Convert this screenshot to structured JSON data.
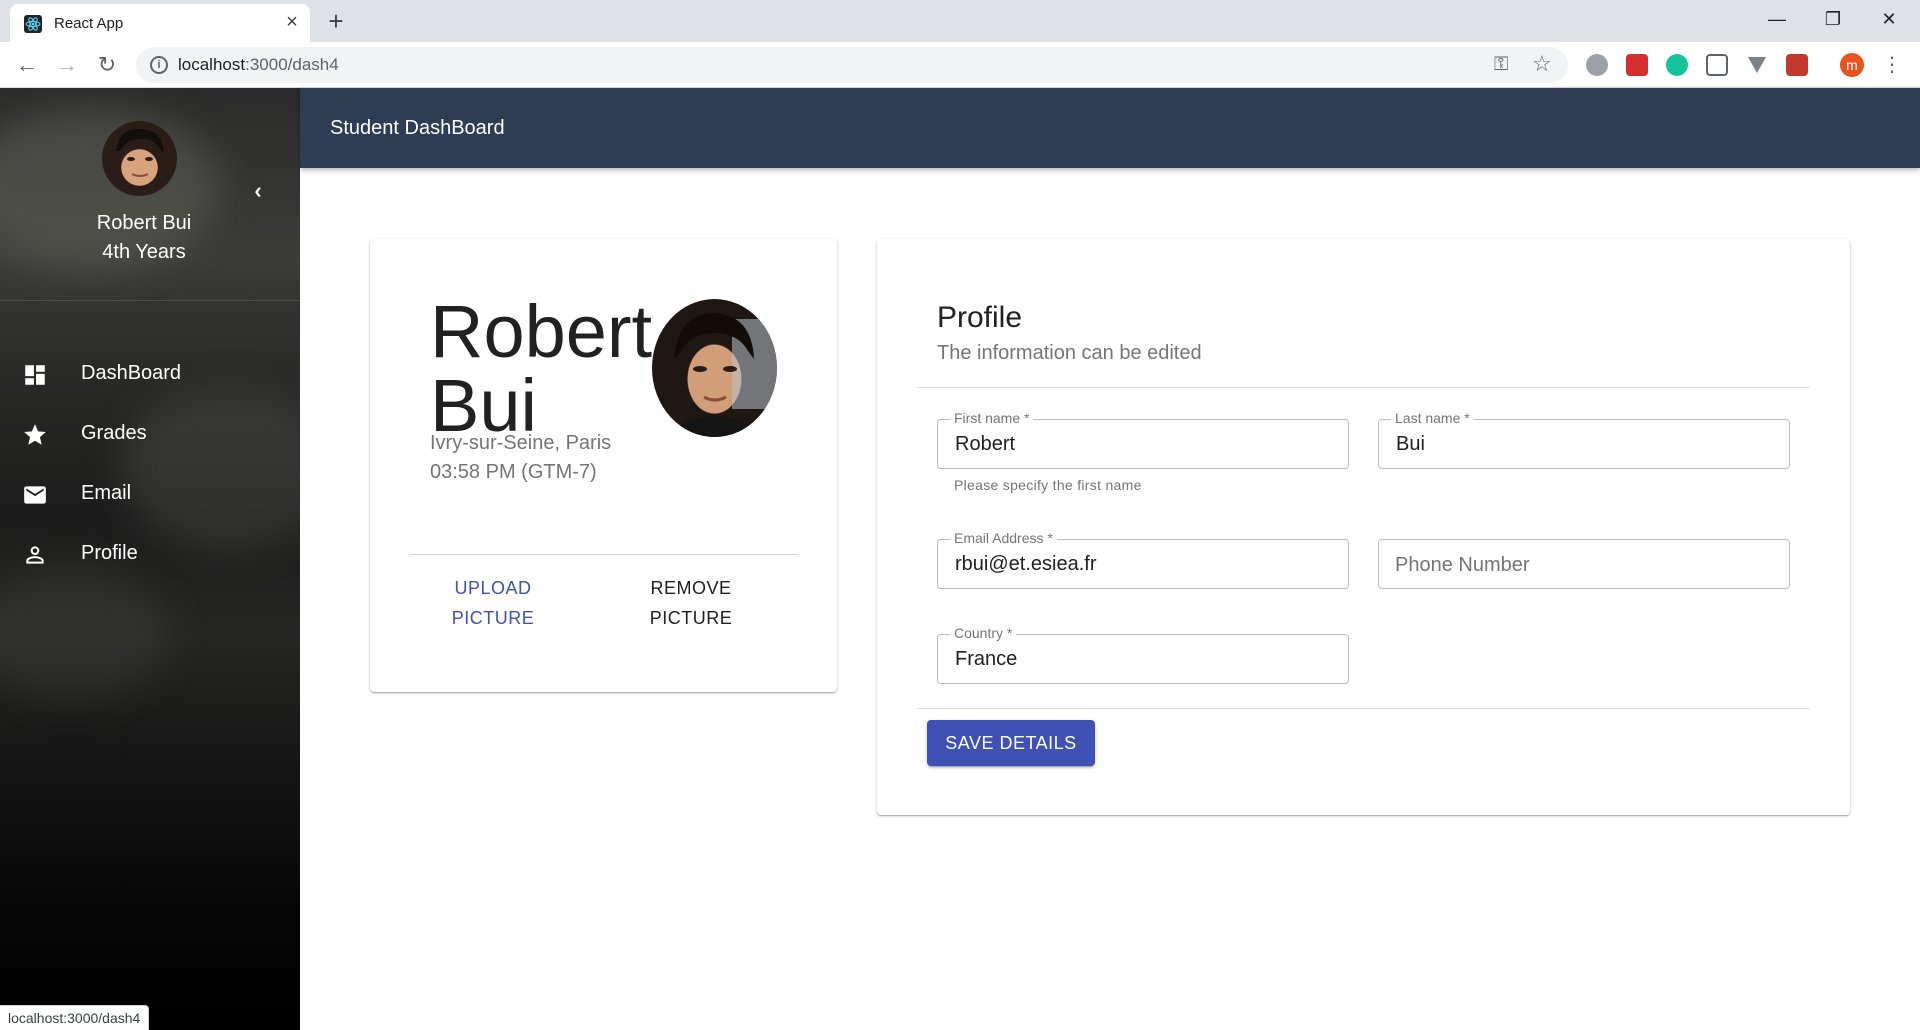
{
  "browser": {
    "tab_title": "React App",
    "tab_close": "×",
    "new_tab": "+",
    "url_host": "localhost",
    "url_path": ":3000/dash4",
    "status_url": "localhost:3000/dash4",
    "win_minimize": "—",
    "win_restore": "❐",
    "win_close": "✕",
    "extension_avatar_letter": "m"
  },
  "sidebar": {
    "name": "Robert Bui",
    "year": "4th Years",
    "collapse_icon": "chevron-left-icon",
    "items": [
      {
        "label": "DashBoard",
        "icon": "dashboard-icon"
      },
      {
        "label": "Grades",
        "icon": "star-icon"
      },
      {
        "label": "Email",
        "icon": "mail-icon"
      },
      {
        "label": "Profile",
        "icon": "person-icon"
      }
    ]
  },
  "appbar": {
    "title": "Student DashBoard"
  },
  "profile_card": {
    "first_name": "Robert",
    "last_name": "Bui",
    "city": "Ivry-sur-Seine, Paris",
    "time": "03:58 PM (GTM-7)",
    "upload_line1": "UPLOAD",
    "upload_line2": "PICTURE",
    "remove_line1": "REMOVE",
    "remove_line2": "PICTURE"
  },
  "form": {
    "title": "Profile",
    "subtitle": "The information can be edited",
    "first_name_label": "First name *",
    "first_name_value": "Robert",
    "first_name_helper": "Please specify the first name",
    "last_name_label": "Last name *",
    "last_name_value": "Bui",
    "email_label": "Email Address *",
    "email_value": "rbui@et.esiea.fr",
    "phone_placeholder": "Phone Number",
    "country_label": "Country *",
    "country_value": "France",
    "save_label": "SAVE DETAILS"
  },
  "colors": {
    "appbar": "#2e3d54",
    "primary": "#3f51b5"
  }
}
